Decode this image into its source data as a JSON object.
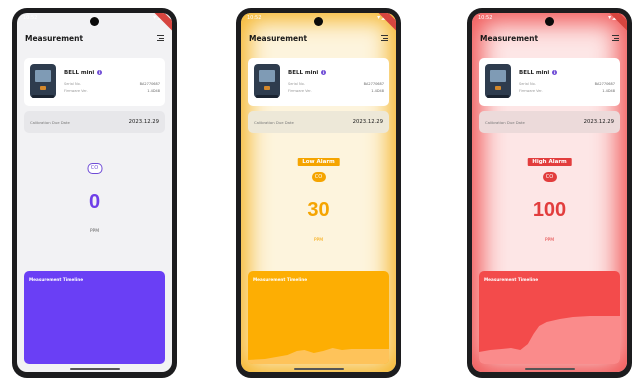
{
  "phones": [
    {
      "status_time": "10:52",
      "status_icons": "▾◢▮",
      "title": "Measurement",
      "device": {
        "name": "BELL mini",
        "serial_label": "Serial No.",
        "serial_value": "BA2770687",
        "firmware_label": "Firmware Ver.",
        "firmware_value": "1.4D48"
      },
      "calibration": {
        "label": "Calibration Due Date",
        "value": "2023.12.29"
      },
      "alarm": "",
      "gas": "CO",
      "reading": "0",
      "unit": "PPM",
      "timeline_title": "Measurement Timeline",
      "color": "#6a3ff5"
    },
    {
      "status_time": "10:52",
      "status_icons": "▾◢▮",
      "title": "Measurement",
      "device": {
        "name": "BELL mini",
        "serial_label": "Serial No.",
        "serial_value": "BA2770687",
        "firmware_label": "Firmware Ver.",
        "firmware_value": "1.4D48"
      },
      "calibration": {
        "label": "Calibration Due Date",
        "value": "2023.12.29"
      },
      "alarm": "Low Alarm",
      "gas": "CO",
      "reading": "30",
      "unit": "PPM",
      "timeline_title": "Measurement Timeline",
      "color": "#fdae03"
    },
    {
      "status_time": "10:52",
      "status_icons": "▾◢▮",
      "title": "Measurement",
      "device": {
        "name": "BELL mini",
        "serial_label": "Serial No.",
        "serial_value": "BA2770687",
        "firmware_label": "Firmware Ver.",
        "firmware_value": "1.4D48"
      },
      "calibration": {
        "label": "Calibration Due Date",
        "value": "2023.12.29"
      },
      "alarm": "High Alarm",
      "gas": "CO",
      "reading": "100",
      "unit": "PPM",
      "timeline_title": "Measurement Timeline",
      "color": "#f34b4b"
    }
  ],
  "icons": {
    "menu": "menu-icon",
    "info": "info-icon",
    "camera": "camera-icon"
  }
}
